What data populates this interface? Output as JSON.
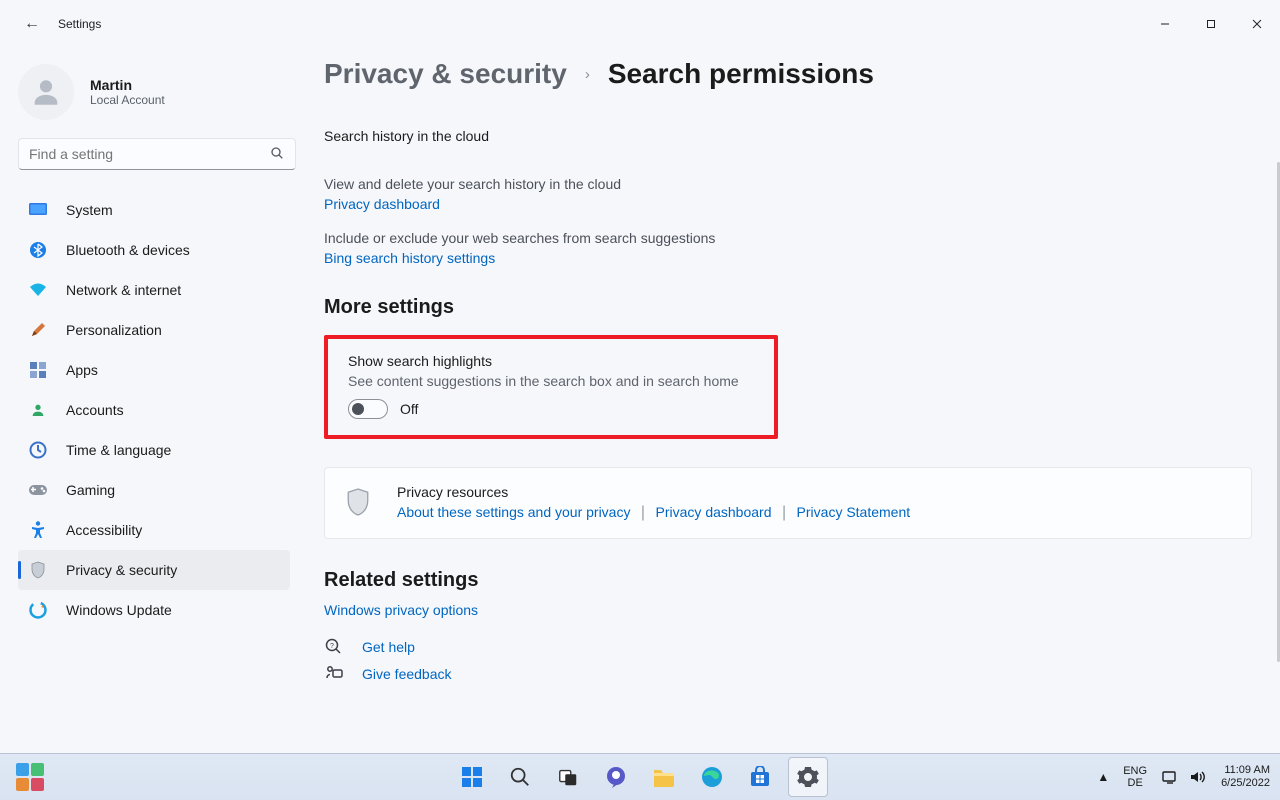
{
  "window": {
    "title": "Settings"
  },
  "profile": {
    "name": "Martin",
    "sub": "Local Account"
  },
  "search": {
    "placeholder": "Find a setting"
  },
  "nav": {
    "items": [
      {
        "label": "System"
      },
      {
        "label": "Bluetooth & devices"
      },
      {
        "label": "Network & internet"
      },
      {
        "label": "Personalization"
      },
      {
        "label": "Apps"
      },
      {
        "label": "Accounts"
      },
      {
        "label": "Time & language"
      },
      {
        "label": "Gaming"
      },
      {
        "label": "Accessibility"
      },
      {
        "label": "Privacy & security"
      },
      {
        "label": "Windows Update"
      }
    ]
  },
  "breadcrumb": {
    "parent": "Privacy & security",
    "current": "Search permissions"
  },
  "cloud": {
    "title": "Search history in the cloud",
    "desc": "View and delete your search history in the cloud",
    "link1": "Privacy dashboard",
    "desc2": "Include or exclude your web searches from search suggestions",
    "link2": "Bing search history settings"
  },
  "more": {
    "heading": "More settings"
  },
  "highlight": {
    "title": "Show search highlights",
    "sub": "See content suggestions in the search box and in search home",
    "state": "Off"
  },
  "card": {
    "title": "Privacy resources",
    "link1": "About these settings and your privacy",
    "link2": "Privacy dashboard",
    "link3": "Privacy Statement"
  },
  "related": {
    "heading": "Related settings",
    "link": "Windows privacy options"
  },
  "help": {
    "gethelp": "Get help",
    "feedback": "Give feedback"
  },
  "taskbar": {
    "lang1": "ENG",
    "lang2": "DE",
    "time": "11:09 AM",
    "date": "6/25/2022"
  }
}
